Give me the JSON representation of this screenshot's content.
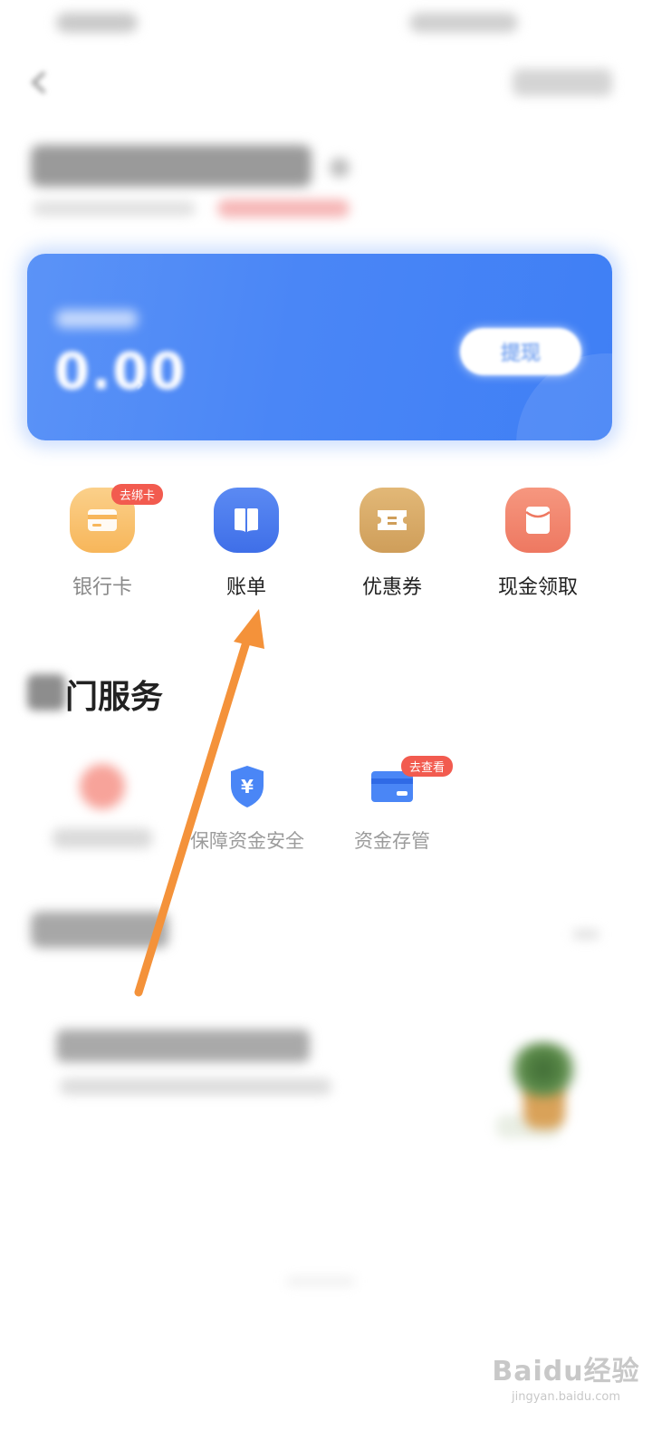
{
  "card": {
    "amount": "0.00",
    "amount_arrow": "›",
    "withdraw_label": "提现"
  },
  "quick_actions": [
    {
      "label": "银行卡",
      "icon": "bank-card-icon",
      "color": "#f9c06b",
      "badge": "去绑卡",
      "muted": true
    },
    {
      "label": "账单",
      "icon": "bill-book-icon",
      "color": "#4f7ef0",
      "badge": ""
    },
    {
      "label": "优惠券",
      "icon": "coupon-icon",
      "color": "#d9ad6a",
      "badge": ""
    },
    {
      "label": "现金领取",
      "icon": "red-envelope-icon",
      "color": "#f28a72",
      "badge": ""
    }
  ],
  "hot_services": {
    "title": "门服务",
    "items": [
      {
        "label": "",
        "icon": "coin-icon",
        "badge": ""
      },
      {
        "label": "保障资金安全",
        "icon": "yuan-shield-icon",
        "badge": ""
      },
      {
        "label": "资金存管",
        "icon": "card-icon",
        "badge": "去查看"
      }
    ]
  },
  "arrow": {
    "color": "#f4923a"
  },
  "watermark": {
    "main": "Baidu经验",
    "sub": "jingyan.baidu.com"
  },
  "colors": {
    "card_blue": "#4a86f6",
    "badge_red": "#f25b4f"
  }
}
